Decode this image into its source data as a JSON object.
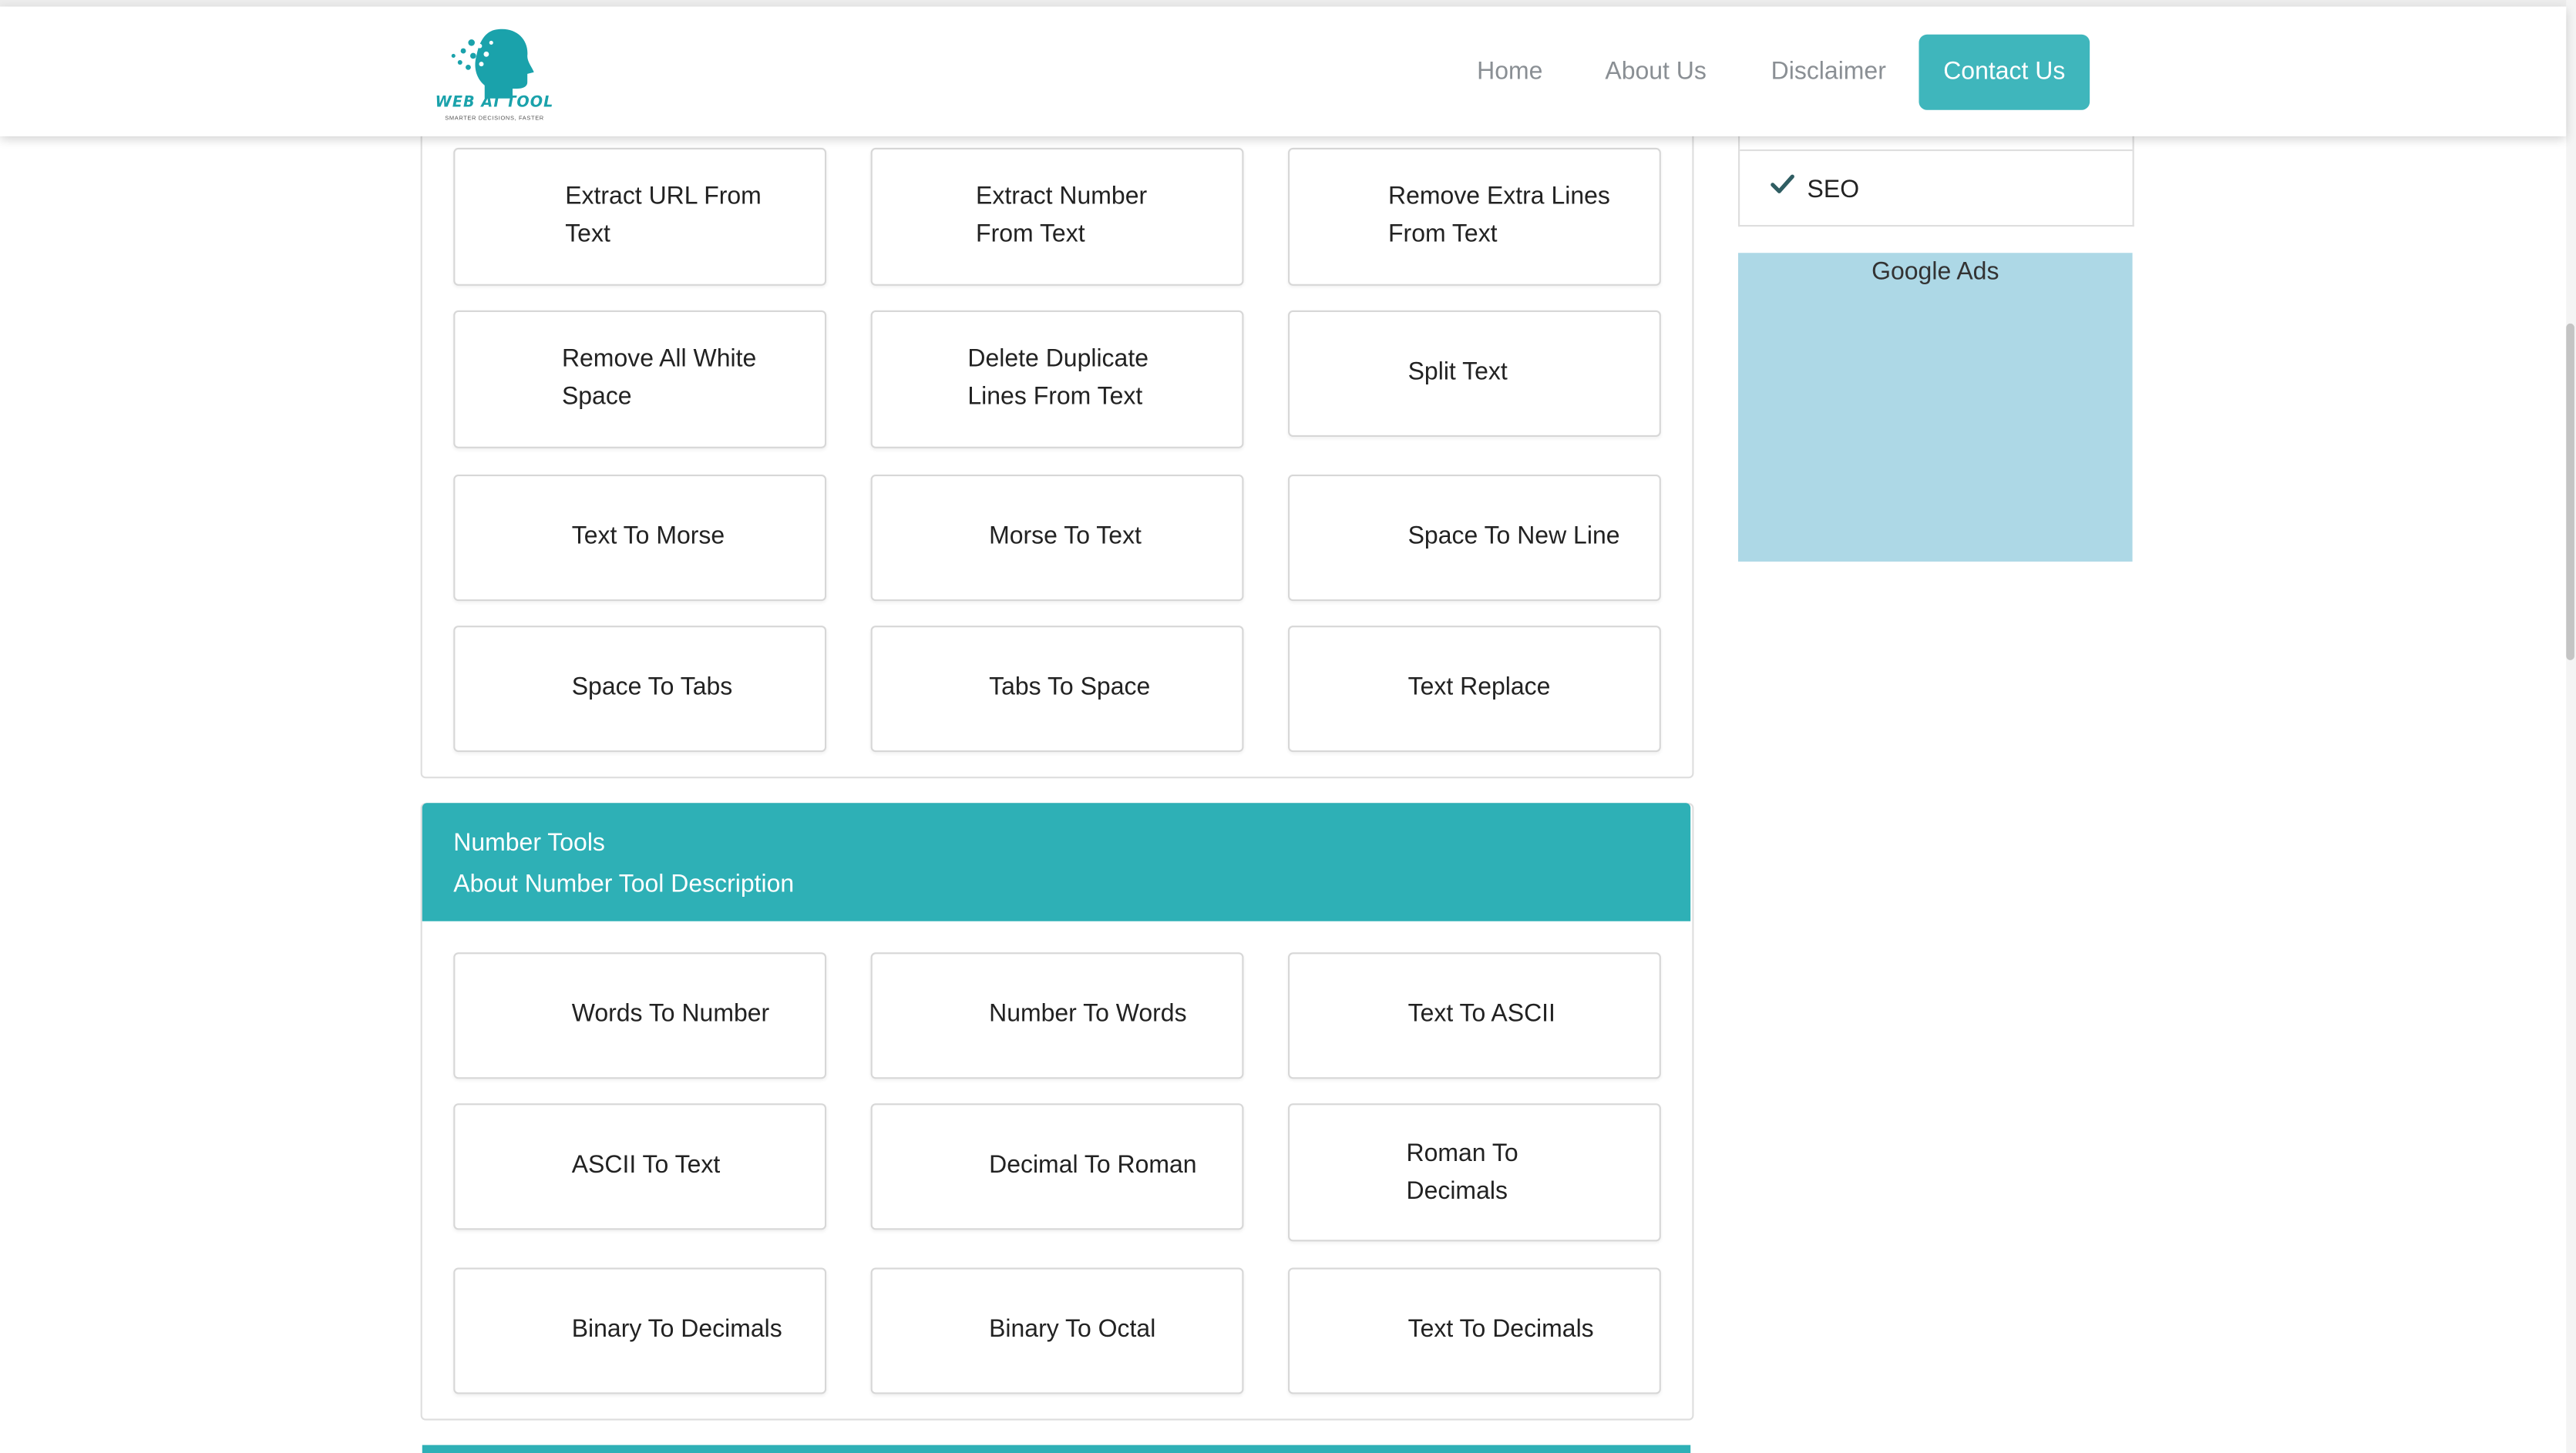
{
  "navbar": {
    "logo_text": "WEB AI TOOL",
    "logo_tagline": "SMARTER DECISIONS, FASTER",
    "links": [
      "Home",
      "About Us",
      "Disclaimer"
    ],
    "contact": "Contact Us",
    "accent_color": "#3fb6bc"
  },
  "text_tools": {
    "rows": [
      [
        [
          "Extract URL From",
          "Text"
        ],
        [
          "Extract Number",
          "From Text"
        ],
        [
          "Remove Extra Lines",
          "From Text"
        ]
      ],
      [
        [
          "Remove All White",
          "Space"
        ],
        [
          "Delete Duplicate",
          "Lines From Text"
        ],
        [
          "Split Text"
        ]
      ],
      [
        [
          "Text To Morse"
        ],
        [
          "Morse To Text"
        ],
        [
          "Space To New Line"
        ]
      ],
      [
        [
          "Space To Tabs"
        ],
        [
          "Tabs To Space"
        ],
        [
          "Text Replace"
        ]
      ]
    ]
  },
  "number_tools": {
    "title": "Number Tools",
    "description": "About Number Tool Description",
    "header_color": "#2eb0b6",
    "rows": [
      [
        [
          "Words To Number"
        ],
        [
          "Number To Words"
        ],
        [
          "Text To ASCII"
        ]
      ],
      [
        [
          "ASCII To Text"
        ],
        [
          "Decimal To Roman"
        ],
        [
          "Roman To",
          "Decimals"
        ]
      ],
      [
        [
          "Binary To Decimals"
        ],
        [
          "Binary To Octal"
        ],
        [
          "Text To Decimals"
        ]
      ]
    ]
  },
  "sidebar": {
    "item": "SEO",
    "item_icon": "check-icon",
    "ad_label": "Google Ads",
    "ad_color": "#add8e6"
  }
}
